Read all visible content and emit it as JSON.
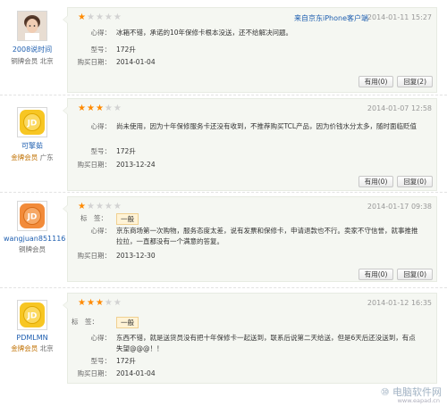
{
  "colors": {
    "star_on": "#ff8a00",
    "star_off": "#d2d2d2",
    "link_blue": "#1f5fb0",
    "panel_bg": "#f5f7f2",
    "gold_member": "#c07000"
  },
  "reviews": [
    {
      "user": {
        "name": "2008说时间",
        "level": "铜牌会员",
        "location": "北京",
        "avatar": "photo-avatar"
      },
      "rating": 1,
      "source": "来自京东iPhone客户端",
      "time": "2014-01-11 15:27",
      "fields": [
        {
          "label": "心得：",
          "value": "冰箱不错，承诺的10年保修卡根本没送，还不给解决问题。"
        },
        {
          "label": "型号：",
          "value": "172升"
        },
        {
          "label": "购买日期：",
          "value": "2014-01-04"
        }
      ],
      "buttons": {
        "useful": "有用(0)",
        "reply": "回复(2)"
      }
    },
    {
      "user": {
        "name": "可擎茹",
        "level": "金牌会员",
        "location": "广东",
        "avatar": "jd-avatar"
      },
      "rating": 3,
      "source": "",
      "time": "2014-01-07 12:58",
      "fields": [
        {
          "label": "心得：",
          "value": "尚未使用，因为十年保修服务卡还没有收到，不推荐购买TCL产品，因为价钱水分太多，随时面临贬值"
        },
        {
          "label": "型号：",
          "value": "172升"
        },
        {
          "label": "购买日期：",
          "value": "2013-12-24"
        }
      ],
      "buttons": {
        "useful": "有用(0)",
        "reply": "回复(0)"
      }
    },
    {
      "user": {
        "name": "wangjuan851116",
        "level": "铜牌会员",
        "location": "",
        "avatar": "jd-avatar"
      },
      "rating": 1,
      "source": "",
      "time": "2014-01-17 09:38",
      "tag_label": "标　签：",
      "tag": "一般",
      "fields": [
        {
          "label": "心得：",
          "value": "京东商场第一次购物，服务态度太差，说有发票和保修卡，申请退款也不行。卖家不守信誉，就事推推拉拉，一直都没有一个满意的答复。"
        },
        {
          "label": "购买日期：",
          "value": "2013-12-30"
        }
      ],
      "buttons": {
        "useful": "有用(0)",
        "reply": "回复(0)"
      }
    },
    {
      "user": {
        "name": "PDMLMN",
        "level": "金牌会员",
        "location": "北京",
        "avatar": "jd-avatar"
      },
      "rating": 3,
      "source": "",
      "time": "2014-01-12 16:35",
      "tag_label": "标　签：",
      "tag": "一般",
      "fields": [
        {
          "label": "心得：",
          "value": "东西不错，就是送货员没有把十年保修卡一起送到，联系后说第二天给送，但是6天后还没送到，有点失望@@@！！"
        },
        {
          "label": "型号：",
          "value": "172升"
        },
        {
          "label": "购买日期：",
          "value": "2014-01-04"
        }
      ],
      "buttons": {
        "useful": "有用(0)",
        "reply": "回复(0)"
      }
    }
  ],
  "watermark": {
    "text": "⑩ 电脑软件网",
    "url": "www.eapad.cn"
  }
}
